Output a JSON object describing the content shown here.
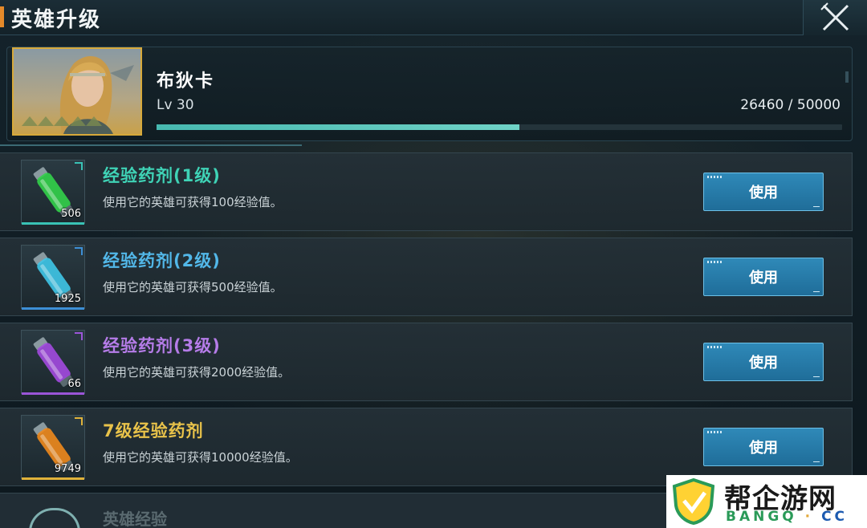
{
  "header": {
    "title": "英雄升级",
    "close_icon": "close-x-icon"
  },
  "hero": {
    "name": "布狄卡",
    "level": "Lv 30",
    "exp_text": "26460 / 50000",
    "exp_fraction": 0.5292
  },
  "items": [
    {
      "name": "经验药剂(1级)",
      "desc": "使用它的英雄可获得100经验值。",
      "count": "506",
      "button": "使用",
      "color": "#3fd3b6",
      "potion_color": "#33d14a",
      "rarity_color": "#39c2b5",
      "icon": "green-potion-icon"
    },
    {
      "name": "经验药剂(2级)",
      "desc": "使用它的英雄可获得500经验值。",
      "count": "1925",
      "button": "使用",
      "color": "#52b7e8",
      "potion_color": "#3fc6e8",
      "rarity_color": "#3d8fd6",
      "icon": "blue-potion-icon"
    },
    {
      "name": "经验药剂(3级)",
      "desc": "使用它的英雄可获得2000经验值。",
      "count": "66",
      "button": "使用",
      "color": "#b57ce8",
      "potion_color": "#a34ae0",
      "rarity_color": "#9b55d8",
      "icon": "purple-potion-icon"
    },
    {
      "name": "7级经验药剂",
      "desc": "使用它的英雄可获得10000经验值。",
      "count": "9749",
      "button": "使用",
      "color": "#e8c24a",
      "potion_color": "#f08a1c",
      "rarity_color": "#e0b23a",
      "icon": "orange-potion-icon"
    }
  ],
  "partial_item": {
    "name": "英雄经验"
  },
  "watermark": {
    "title": "帮企游网",
    "sub_main": "BANGQ",
    "sub_dot": "·",
    "sub_cc": "CC",
    "icon": "shield-logo-icon"
  }
}
